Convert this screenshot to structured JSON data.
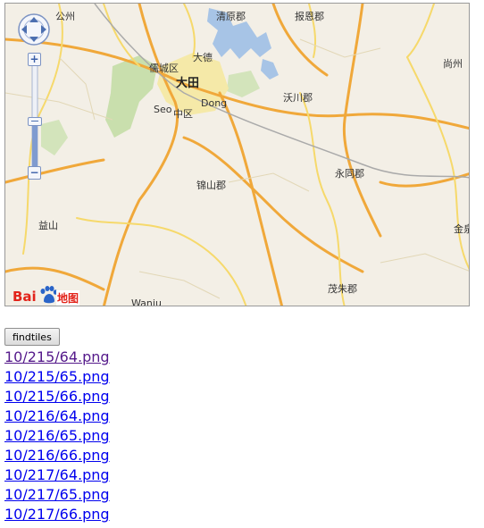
{
  "map": {
    "place_labels": {
      "gongzhou": "公州",
      "qingyuan": "清原郡",
      "baoen": "报恩郡",
      "shangzhou": "尚州",
      "rucheng": "儒城区",
      "dade": "大德",
      "datian": "大田",
      "dong": "Dong",
      "seo": "Seo",
      "zhongqu": "中区",
      "wochuan": "沃川郡",
      "yongtong": "永同郡",
      "jinshan": "锦山郡",
      "yishan": "益山",
      "jinquan": "金泉",
      "maozhu": "茂朱郡",
      "wanju": "Wanju"
    },
    "logo_text": "地图",
    "logo_brand": "Bai"
  },
  "controls": {
    "zoom_in": "+",
    "zoom_out": "−"
  },
  "findtiles_label": "findtiles",
  "tiles": [
    {
      "label": "10/215/64.png",
      "visited": true
    },
    {
      "label": "10/215/65.png",
      "visited": false
    },
    {
      "label": "10/215/66.png",
      "visited": false
    },
    {
      "label": "10/216/64.png",
      "visited": false
    },
    {
      "label": "10/216/65.png",
      "visited": false
    },
    {
      "label": "10/216/66.png",
      "visited": false
    },
    {
      "label": "10/217/64.png",
      "visited": false
    },
    {
      "label": "10/217/65.png",
      "visited": false
    },
    {
      "label": "10/217/66.png",
      "visited": false
    }
  ]
}
